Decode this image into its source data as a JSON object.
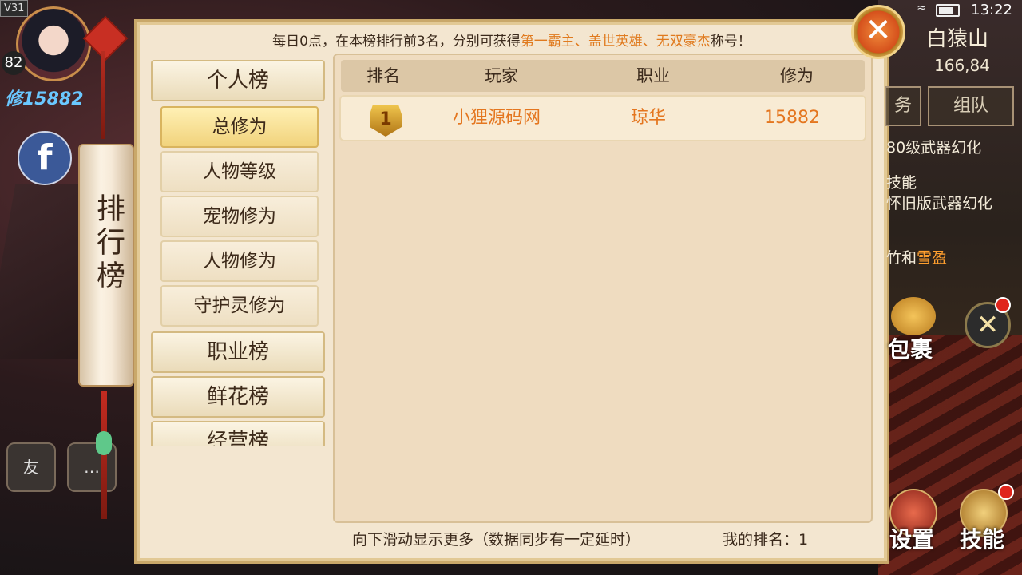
{
  "status": {
    "version": "V31",
    "time": "13:22"
  },
  "player": {
    "level": "82",
    "power": "修15882"
  },
  "bottom_buttons": [
    "友",
    "…"
  ],
  "scroll_title": "排行榜",
  "notice": {
    "prefix": "每日0点，在本榜排行前3名，分别可获得",
    "highlight": "第一霸主、盖世英雄、无双豪杰",
    "suffix": "称号！"
  },
  "sidebar": {
    "personal": "个人榜",
    "sub_items": [
      "总修为",
      "人物等级",
      "宠物修为",
      "人物修为",
      "守护灵修为"
    ],
    "profession": "职业榜",
    "flower": "鲜花榜",
    "business": "经营榜"
  },
  "table": {
    "headers": [
      "排名",
      "玩家",
      "职业",
      "修为"
    ],
    "rows": [
      {
        "rank": "1",
        "player": "小狸源码网",
        "profession": "琼华",
        "power": "15882"
      }
    ]
  },
  "footer": {
    "hint": "向下滑动显示更多（数据同步有一定延时）",
    "my_rank_label": "我的排名：",
    "my_rank_value": "1"
  },
  "right_hud": {
    "map_name": "白猿山",
    "coords": "166,84",
    "btn_task": "务",
    "btn_team": "组队",
    "quest_lines": [
      "80级武器幻化",
      "技能",
      "怀旧版武器幻化"
    ],
    "quest_hl_prefix": "竹和",
    "quest_hl": "雪盈",
    "bag": "包裹",
    "settings": "设置",
    "skills": "技能"
  },
  "colors": {
    "highlight": "#e07a1e",
    "panel_bg": "#f3e6d0"
  }
}
